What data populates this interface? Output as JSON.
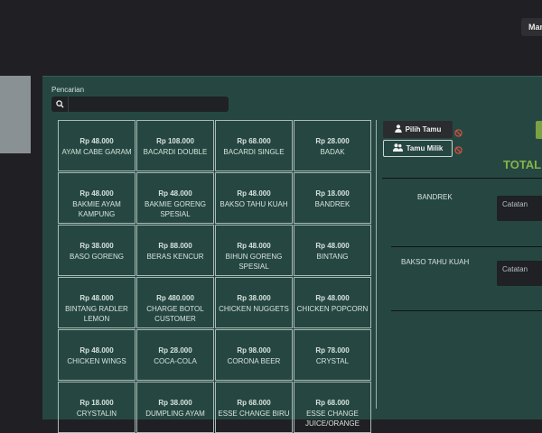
{
  "topbar": {
    "button_label": "Mana"
  },
  "search": {
    "label": "Pencarian",
    "placeholder": "",
    "value": ""
  },
  "products": [
    {
      "price": "Rp 48.000",
      "name": "AYAM CABE GARAM"
    },
    {
      "price": "Rp 108.000",
      "name": "BACARDI DOUBLE"
    },
    {
      "price": "Rp 68.000",
      "name": "BACARDI SINGLE"
    },
    {
      "price": "Rp 28.000",
      "name": "BADAK"
    },
    {
      "price": "Rp 48.000",
      "name": "BAKMIE AYAM KAMPUNG"
    },
    {
      "price": "Rp 48.000",
      "name": "BAKMIE GORENG SPESIAL"
    },
    {
      "price": "Rp 48.000",
      "name": "BAKSO TAHU KUAH"
    },
    {
      "price": "Rp 18.000",
      "name": "BANDREK"
    },
    {
      "price": "Rp 38.000",
      "name": "BASO GORENG"
    },
    {
      "price": "Rp 88.000",
      "name": "BERAS KENCUR"
    },
    {
      "price": "Rp 48.000",
      "name": "BIHUN GORENG SPESIAL"
    },
    {
      "price": "Rp 48.000",
      "name": "BINTANG"
    },
    {
      "price": "Rp 48.000",
      "name": "BINTANG RADLER LEMON"
    },
    {
      "price": "Rp 480.000",
      "name": "CHARGE BOTOL CUSTOMER"
    },
    {
      "price": "Rp 38.000",
      "name": "CHICKEN NUGGETS"
    },
    {
      "price": "Rp 48.000",
      "name": "CHICKEN POPCORN"
    },
    {
      "price": "Rp 48.000",
      "name": "CHICKEN WINGS"
    },
    {
      "price": "Rp 28.000",
      "name": "COCA-COLA"
    },
    {
      "price": "Rp 98.000",
      "name": "CORONA BEER"
    },
    {
      "price": "Rp 78.000",
      "name": "CRYSTAL"
    },
    {
      "price": "Rp 18.000",
      "name": "CRYSTALIN"
    },
    {
      "price": "Rp 38.000",
      "name": "DUMPLING AYAM"
    },
    {
      "price": "Rp 68.000",
      "name": "ESSE CHANGE BIRU"
    },
    {
      "price": "Rp 68.000",
      "name": "ESSE CHANGE JUICE/ORANGE"
    }
  ],
  "guest": {
    "pilih_label": "Pilih Tamu",
    "tamu_milik_label": "Tamu Milik"
  },
  "order": {
    "total_label": "TOTAL:",
    "items": [
      {
        "name": "BANDREK",
        "note_placeholder": "Catatan"
      },
      {
        "name": "BAKSO TAHU KUAH",
        "note_placeholder": "Catatan"
      }
    ]
  },
  "colors": {
    "accent_green": "#86b34b",
    "panel_bg": "#264741",
    "danger": "#e05040"
  },
  "icons": [
    "search-icon",
    "user-icon",
    "users-icon",
    "ban-icon"
  ]
}
